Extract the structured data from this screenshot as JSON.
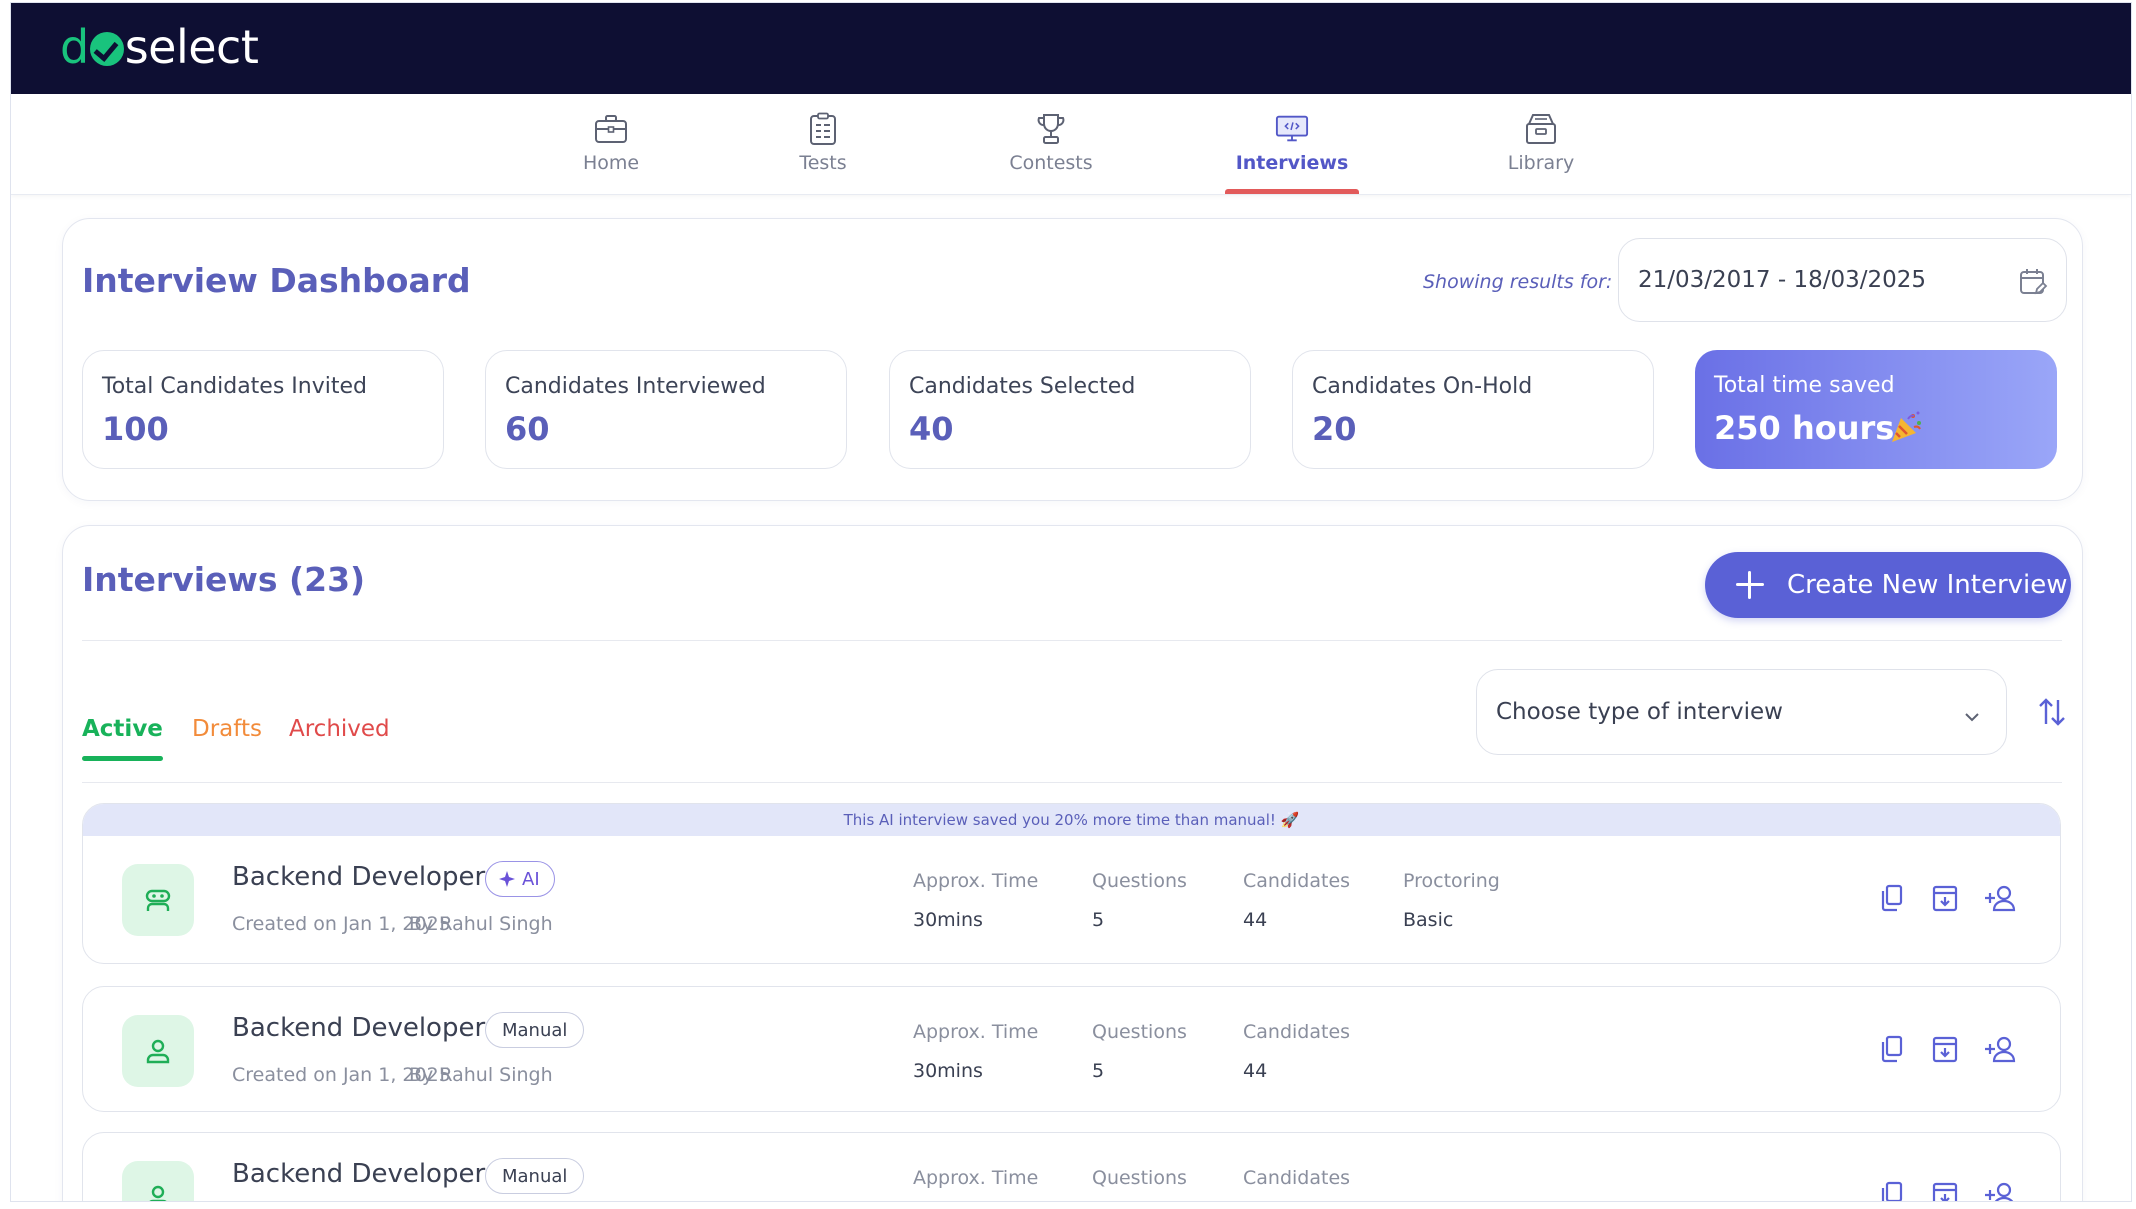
{
  "brand": {
    "logo_d": "d",
    "logo_rest": "select"
  },
  "nav": [
    {
      "label": "Home"
    },
    {
      "label": "Tests"
    },
    {
      "label": "Contests"
    },
    {
      "label": "Interviews"
    },
    {
      "label": "Library"
    }
  ],
  "dashboard": {
    "title": "Interview Dashboard",
    "showing_label": "Showing results for:",
    "date_range": "21/03/2017 - 18/03/2025",
    "stats": [
      {
        "label": "Total Candidates Invited",
        "value": "100"
      },
      {
        "label": "Candidates Interviewed",
        "value": "60"
      },
      {
        "label": "Candidates Selected",
        "value": "40"
      },
      {
        "label": "Candidates On-Hold",
        "value": "20"
      },
      {
        "label": "Total time saved",
        "value": "250 hours"
      }
    ]
  },
  "interviews": {
    "title": "Interviews (23)",
    "create_label": "Create New Interview",
    "tabs": [
      {
        "label": "Active"
      },
      {
        "label": "Drafts"
      },
      {
        "label": "Archived"
      }
    ],
    "type_select": "Choose type of interview",
    "banner": "This AI interview saved you 20% more time than manual! 🚀",
    "rows": [
      {
        "role": "Backend Developer",
        "badge": "AI",
        "created": "Created on Jan 1, 2025",
        "by": "By Rahul Singh",
        "time_label": "Approx. Time",
        "time": "30mins",
        "questions_label": "Questions",
        "questions": "5",
        "candidates_label": "Candidates",
        "candidates": "44",
        "proctoring_label": "Proctoring",
        "proctoring": "Basic"
      },
      {
        "role": "Backend Developer",
        "badge": "Manual",
        "created": "Created on Jan 1, 2025",
        "by": "By Rahul Singh",
        "time_label": "Approx. Time",
        "time": "30mins",
        "questions_label": "Questions",
        "questions": "5",
        "candidates_label": "Candidates",
        "candidates": "44"
      },
      {
        "role": "Backend Developer",
        "badge": "Manual",
        "time_label": "Approx. Time",
        "questions_label": "Questions",
        "candidates_label": "Candidates"
      }
    ]
  },
  "colors": {
    "brand_bar": "#0e0f33",
    "brand_green": "#19c37d",
    "accent": "#5a61d6",
    "title": "#5a5fb9",
    "nav_active_underline": "#e25a5a",
    "tab_active": "#18b25a",
    "tab_drafts": "#f28b3a",
    "tab_archived": "#e04a4a"
  }
}
